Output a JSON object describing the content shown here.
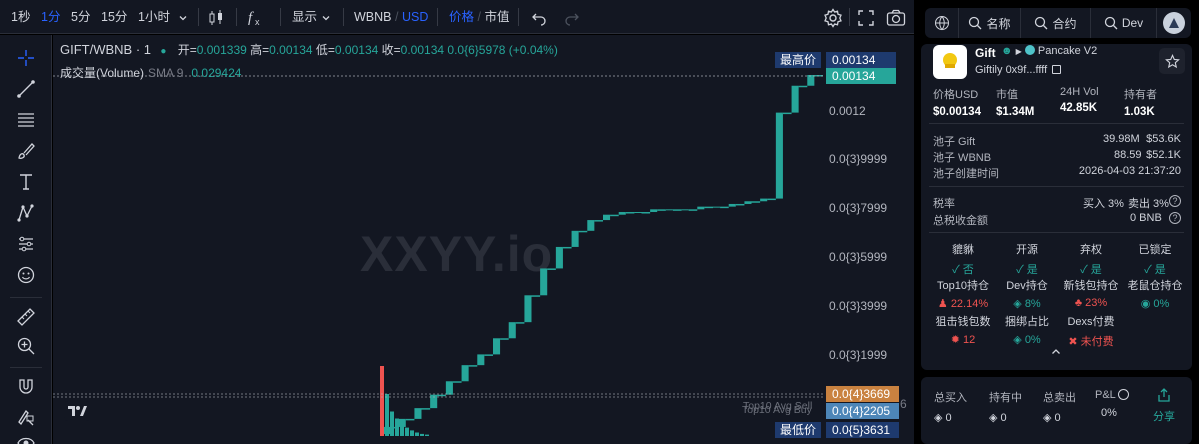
{
  "toolbar": {
    "intervals": [
      "1秒",
      "1分",
      "5分",
      "15分",
      "1小时"
    ],
    "active_interval": "1分",
    "display_label": "显示",
    "pair_base": "WBNB",
    "pair_sep": "/",
    "pair_quote": "USD",
    "mode_price": "价格",
    "mode_sep": "/",
    "mode_mcap": "市值"
  },
  "chart": {
    "symbol": "GIFT/WBNB · 1",
    "ohlc": {
      "open_label": "开=",
      "open": "0.001339",
      "high_label": "高=",
      "high": "0.00134",
      "low_label": "低=",
      "low": "0.00134",
      "close_label": "收=",
      "close": "0.00134",
      "change": "0.0{6}5978 (+0.04%)"
    },
    "volume_label": "成交量(Volume)",
    "sma_label": "SMA 9",
    "volume_value": "0.029424",
    "watermark": "XXYY.io",
    "y_ticks": [
      "0.0012",
      "0.0{3}9999",
      "0.0{3}7999",
      "0.0{3}5999",
      "0.0{3}3999",
      "0.0{3}1999"
    ],
    "labels": {
      "high_tag": "最高价",
      "high_value": "0.00134",
      "last_value": "0.00134",
      "top10_sell": "Top10 Avg Sell",
      "top10_sell_value": "0.0{4}3669",
      "top10_buy": "Top10 Avg Buy",
      "top10_buy_value": "0.0{4}2205",
      "low_tag": "最低价",
      "low_value": "0.0{5}3631",
      "edge_digit": "6"
    },
    "colors": {
      "up": "#26a69a",
      "down": "#ef5350",
      "accent": "#2962ff"
    }
  },
  "chart_data": {
    "type": "candlestick",
    "title": "GIFT/WBNB · 1",
    "y_ticks": [
      "0.0012",
      "0.0{3}9999",
      "0.0{3}7999",
      "0.0{3}5999",
      "0.0{3}3999",
      "0.0{3}1999"
    ],
    "y_range": [
      0,
      0.00134
    ],
    "series": [
      {
        "name": "价格",
        "values": [
          3.6e-06,
          3e-05,
          6e-05,
          0.0001,
          0.00015,
          0.0002,
          0.00026,
          0.0003,
          0.00036,
          0.00042,
          0.00052,
          0.00062,
          0.0007,
          0.00076,
          0.0008,
          0.00082,
          0.00083,
          0.00083,
          0.00084,
          0.00084,
          0.00084,
          0.00085,
          0.00085,
          0.00086,
          0.00087,
          0.00088,
          0.0012,
          0.0013,
          0.00134
        ]
      },
      {
        "name": "成交量(Volume)",
        "values": [
          1.0,
          0.6,
          0.35,
          0.25,
          0.18,
          0.12,
          0.08,
          0.05,
          0.03,
          0.02
        ]
      }
    ]
  },
  "panel": {
    "nav": {
      "name_label": "名称",
      "contract_label": "合约",
      "dev_label": "Dev"
    },
    "token": {
      "name": "Gift",
      "dex": "Pancake V2",
      "subname": "Giftily",
      "address": "0x9f...ffff",
      "logo_text": "Giftily"
    },
    "stats": [
      {
        "label": "价格USD",
        "value": "$0.00134"
      },
      {
        "label": "市值",
        "value": "$1.34M"
      },
      {
        "label": "24H Vol",
        "value": "42.85K"
      },
      {
        "label": "持有者",
        "value": "1.03K"
      }
    ],
    "pools": [
      {
        "label": "池子 Gift",
        "amount": "39.98M",
        "usd": "$53.6K"
      },
      {
        "label": "池子 WBNB",
        "amount": "88.59",
        "usd": "$52.1K"
      },
      {
        "label": "池子创建时间",
        "amount": "",
        "usd": "2026-04-03 21:37:20"
      }
    ],
    "tax": {
      "label": "税率",
      "buy": "买入 3%",
      "sell": "卖出 3%"
    },
    "total_tax": {
      "label": "总税收金额",
      "value": "0 BNB"
    },
    "security": [
      {
        "label": "貔貅",
        "value": "否",
        "status": "ok"
      },
      {
        "label": "开源",
        "value": "是",
        "status": "ok"
      },
      {
        "label": "弃权",
        "value": "是",
        "status": "ok"
      },
      {
        "label": "已锁定",
        "value": "是",
        "status": "ok"
      }
    ],
    "holdings": [
      {
        "label": "Top10持仓",
        "value": "22.14%",
        "status": "bad"
      },
      {
        "label": "Dev持仓",
        "value": "8%",
        "status": "ok"
      },
      {
        "label": "新钱包持仓",
        "value": "23%",
        "status": "bad"
      },
      {
        "label": "老鼠仓持仓",
        "value": "0%",
        "status": "ok"
      }
    ],
    "extra": [
      {
        "label": "狙击钱包数",
        "value": "12",
        "status": "bad"
      },
      {
        "label": "捆绑占比",
        "value": "0%",
        "status": "ok"
      },
      {
        "label": "Dexs付费",
        "value": "未付费",
        "status": "bad"
      }
    ],
    "footer": [
      {
        "label": "总买入",
        "value": "0"
      },
      {
        "label": "持有中",
        "value": "0"
      },
      {
        "label": "总卖出",
        "value": "0"
      },
      {
        "label": "P&L",
        "value": "0%"
      }
    ],
    "share_label": "分享"
  }
}
